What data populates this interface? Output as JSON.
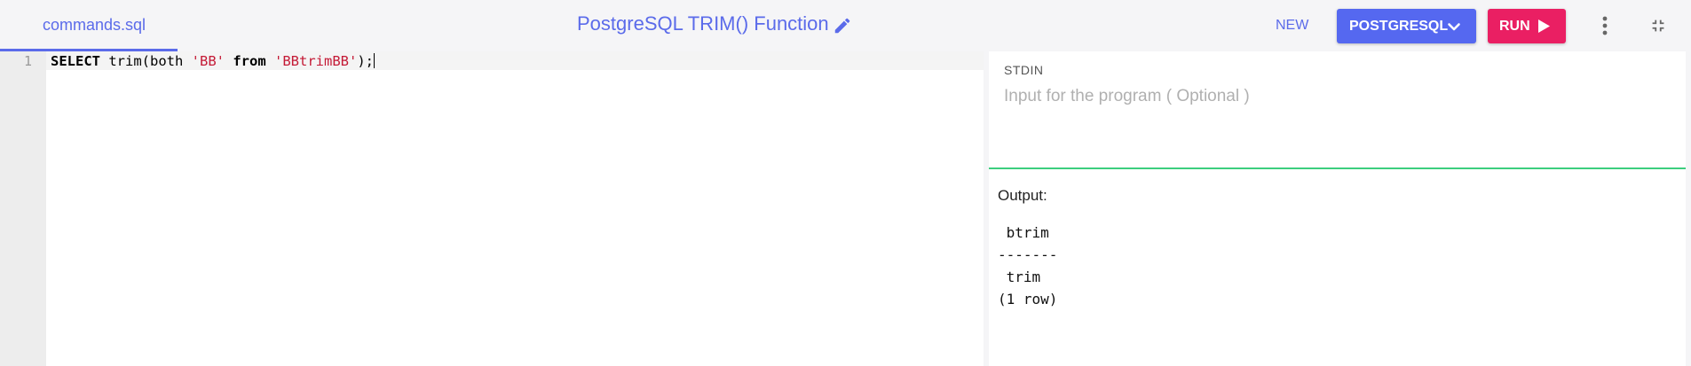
{
  "colors": {
    "accent": "#5b6bea",
    "language_button": "#5568f0",
    "run_button": "#ea1f63",
    "divider": "#3cce7e"
  },
  "header": {
    "file_tab": "commands.sql",
    "title": "PostgreSQL TRIM() Function",
    "edit_icon": "pencil-icon",
    "new_label": "NEW",
    "language_label": "POSTGRESQL",
    "language_icon": "chevron-down-icon",
    "run_label": "RUN",
    "run_icon": "play-icon",
    "menu_icon": "kebab-menu-icon",
    "collapse_icon": "collapse-icon"
  },
  "editor": {
    "line_number": "1",
    "code": {
      "kw_select": "SELECT",
      "fn_open": " trim(both ",
      "str1": "'BB'",
      "sp": " ",
      "kw_from": "from",
      "sp2": " ",
      "str2": "'BBtrimBB'",
      "close": ");"
    }
  },
  "stdin": {
    "label": "STDIN",
    "placeholder": "Input for the program ( Optional )"
  },
  "output": {
    "label": "Output:",
    "text": " btrim\n-------\n trim\n(1 row)"
  }
}
